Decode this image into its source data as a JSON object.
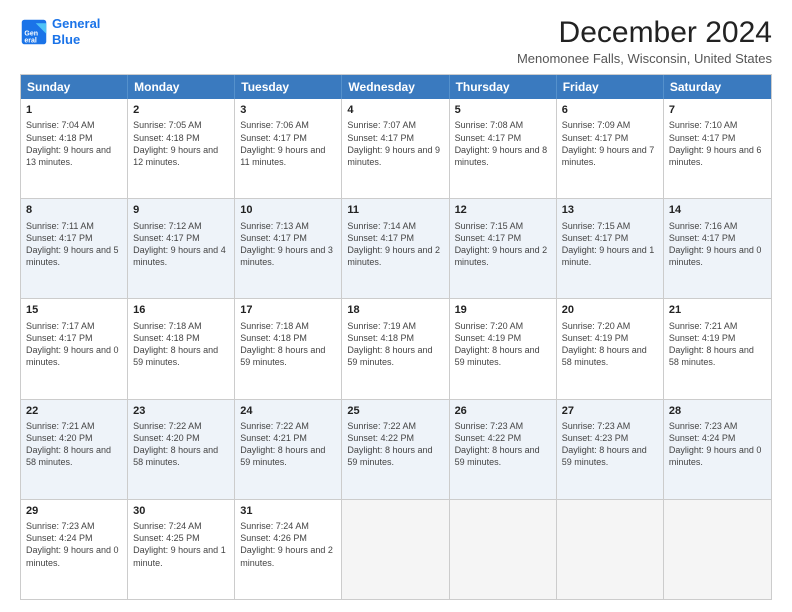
{
  "logo": {
    "line1": "General",
    "line2": "Blue"
  },
  "title": "December 2024",
  "subtitle": "Menomonee Falls, Wisconsin, United States",
  "days_of_week": [
    "Sunday",
    "Monday",
    "Tuesday",
    "Wednesday",
    "Thursday",
    "Friday",
    "Saturday"
  ],
  "weeks": [
    [
      {
        "day": "1",
        "sunrise": "7:04 AM",
        "sunset": "4:18 PM",
        "daylight": "9 hours and 13 minutes."
      },
      {
        "day": "2",
        "sunrise": "7:05 AM",
        "sunset": "4:18 PM",
        "daylight": "9 hours and 12 minutes."
      },
      {
        "day": "3",
        "sunrise": "7:06 AM",
        "sunset": "4:17 PM",
        "daylight": "9 hours and 11 minutes."
      },
      {
        "day": "4",
        "sunrise": "7:07 AM",
        "sunset": "4:17 PM",
        "daylight": "9 hours and 9 minutes."
      },
      {
        "day": "5",
        "sunrise": "7:08 AM",
        "sunset": "4:17 PM",
        "daylight": "9 hours and 8 minutes."
      },
      {
        "day": "6",
        "sunrise": "7:09 AM",
        "sunset": "4:17 PM",
        "daylight": "9 hours and 7 minutes."
      },
      {
        "day": "7",
        "sunrise": "7:10 AM",
        "sunset": "4:17 PM",
        "daylight": "9 hours and 6 minutes."
      }
    ],
    [
      {
        "day": "8",
        "sunrise": "7:11 AM",
        "sunset": "4:17 PM",
        "daylight": "9 hours and 5 minutes."
      },
      {
        "day": "9",
        "sunrise": "7:12 AM",
        "sunset": "4:17 PM",
        "daylight": "9 hours and 4 minutes."
      },
      {
        "day": "10",
        "sunrise": "7:13 AM",
        "sunset": "4:17 PM",
        "daylight": "9 hours and 3 minutes."
      },
      {
        "day": "11",
        "sunrise": "7:14 AM",
        "sunset": "4:17 PM",
        "daylight": "9 hours and 2 minutes."
      },
      {
        "day": "12",
        "sunrise": "7:15 AM",
        "sunset": "4:17 PM",
        "daylight": "9 hours and 2 minutes."
      },
      {
        "day": "13",
        "sunrise": "7:15 AM",
        "sunset": "4:17 PM",
        "daylight": "9 hours and 1 minute."
      },
      {
        "day": "14",
        "sunrise": "7:16 AM",
        "sunset": "4:17 PM",
        "daylight": "9 hours and 0 minutes."
      }
    ],
    [
      {
        "day": "15",
        "sunrise": "7:17 AM",
        "sunset": "4:17 PM",
        "daylight": "9 hours and 0 minutes."
      },
      {
        "day": "16",
        "sunrise": "7:18 AM",
        "sunset": "4:18 PM",
        "daylight": "8 hours and 59 minutes."
      },
      {
        "day": "17",
        "sunrise": "7:18 AM",
        "sunset": "4:18 PM",
        "daylight": "8 hours and 59 minutes."
      },
      {
        "day": "18",
        "sunrise": "7:19 AM",
        "sunset": "4:18 PM",
        "daylight": "8 hours and 59 minutes."
      },
      {
        "day": "19",
        "sunrise": "7:20 AM",
        "sunset": "4:19 PM",
        "daylight": "8 hours and 59 minutes."
      },
      {
        "day": "20",
        "sunrise": "7:20 AM",
        "sunset": "4:19 PM",
        "daylight": "8 hours and 58 minutes."
      },
      {
        "day": "21",
        "sunrise": "7:21 AM",
        "sunset": "4:19 PM",
        "daylight": "8 hours and 58 minutes."
      }
    ],
    [
      {
        "day": "22",
        "sunrise": "7:21 AM",
        "sunset": "4:20 PM",
        "daylight": "8 hours and 58 minutes."
      },
      {
        "day": "23",
        "sunrise": "7:22 AM",
        "sunset": "4:20 PM",
        "daylight": "8 hours and 58 minutes."
      },
      {
        "day": "24",
        "sunrise": "7:22 AM",
        "sunset": "4:21 PM",
        "daylight": "8 hours and 59 minutes."
      },
      {
        "day": "25",
        "sunrise": "7:22 AM",
        "sunset": "4:22 PM",
        "daylight": "8 hours and 59 minutes."
      },
      {
        "day": "26",
        "sunrise": "7:23 AM",
        "sunset": "4:22 PM",
        "daylight": "8 hours and 59 minutes."
      },
      {
        "day": "27",
        "sunrise": "7:23 AM",
        "sunset": "4:23 PM",
        "daylight": "8 hours and 59 minutes."
      },
      {
        "day": "28",
        "sunrise": "7:23 AM",
        "sunset": "4:24 PM",
        "daylight": "9 hours and 0 minutes."
      }
    ],
    [
      {
        "day": "29",
        "sunrise": "7:23 AM",
        "sunset": "4:24 PM",
        "daylight": "9 hours and 0 minutes."
      },
      {
        "day": "30",
        "sunrise": "7:24 AM",
        "sunset": "4:25 PM",
        "daylight": "9 hours and 1 minute."
      },
      {
        "day": "31",
        "sunrise": "7:24 AM",
        "sunset": "4:26 PM",
        "daylight": "9 hours and 2 minutes."
      },
      null,
      null,
      null,
      null
    ]
  ],
  "labels": {
    "sunrise": "Sunrise:",
    "sunset": "Sunset:",
    "daylight": "Daylight:"
  }
}
